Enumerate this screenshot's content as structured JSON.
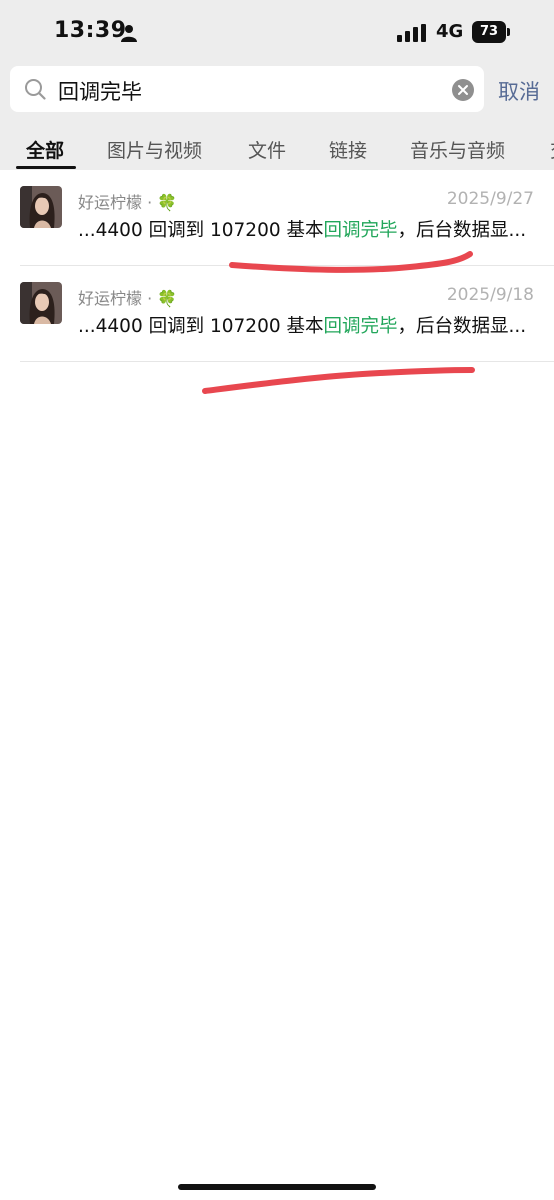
{
  "status": {
    "time": "13:39",
    "network": "4G",
    "battery": "73"
  },
  "search": {
    "query": "回调完毕",
    "cancel_label": "取消"
  },
  "tabs": [
    {
      "label": "全部",
      "active": true
    },
    {
      "label": "图片与视频",
      "active": false
    },
    {
      "label": "文件",
      "active": false
    },
    {
      "label": "链接",
      "active": false
    },
    {
      "label": "音乐与音频",
      "active": false
    },
    {
      "label": "交",
      "active": false
    }
  ],
  "results": [
    {
      "sender": "好运柠檬 · 🍀",
      "date": "2025/9/27",
      "snippet_before": "...4400 回调到 107200 基本",
      "snippet_highlight": "回调完毕",
      "snippet_after": "，后台数据显..."
    },
    {
      "sender": "好运柠檬 · 🍀",
      "date": "2025/9/18",
      "snippet_before": "...4400 回调到 107200 基本",
      "snippet_highlight": "回调完毕",
      "snippet_after": "，后台数据显..."
    }
  ],
  "colors": {
    "highlight": "#21a65a",
    "link": "#576b95",
    "annotation": "#e8474f"
  }
}
